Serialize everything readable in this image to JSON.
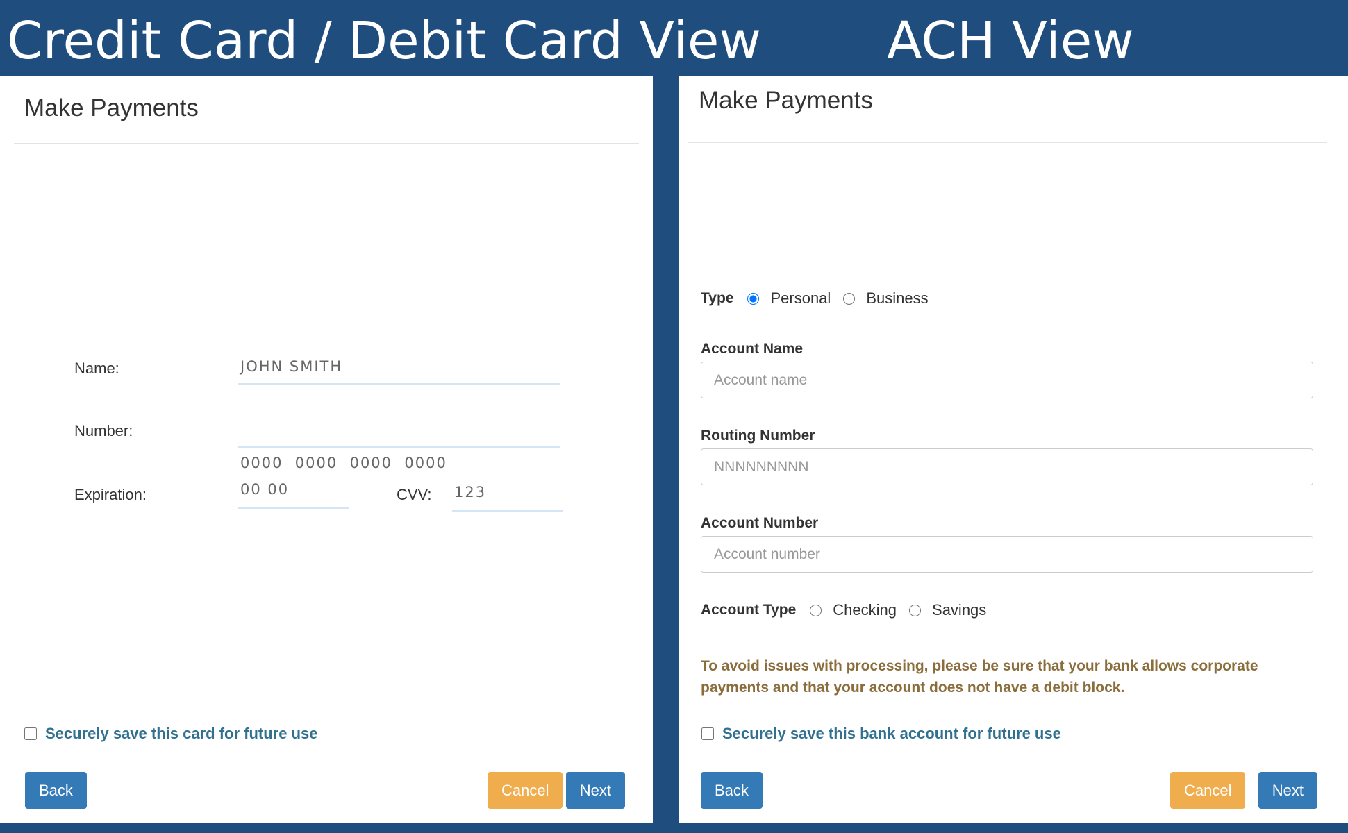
{
  "titles": {
    "cc_view": "Credit Card / Debit Card View",
    "ach_view": "ACH View"
  },
  "cc_panel": {
    "header": "Make Payments",
    "name_label": "Name:",
    "name_value": "JOHN SMITH",
    "number_label": "Number:",
    "number_value": "0000  0000  0000  0000",
    "expiration_label": "Expiration:",
    "expiration_value": "00 00",
    "cvv_label": "CVV:",
    "cvv_value": "123",
    "save_label": "Securely save this card for future use",
    "back": "Back",
    "cancel": "Cancel",
    "next": "Next"
  },
  "ach_panel": {
    "header": "Make Payments",
    "type_label": "Type",
    "type_options": [
      "Personal",
      "Business"
    ],
    "type_selected": "Personal",
    "account_name_label": "Account Name",
    "account_name_placeholder": "Account name",
    "routing_label": "Routing Number",
    "routing_placeholder": "NNNNNNNNN",
    "account_number_label": "Account Number",
    "account_number_placeholder": "Account number",
    "account_type_label": "Account Type",
    "account_type_options": [
      "Checking",
      "Savings"
    ],
    "warning": "To avoid issues with processing, please be sure that your bank allows corporate payments and that your account does not have a debit block.",
    "save_label": "Securely save this bank account for future use",
    "back": "Back",
    "cancel": "Cancel",
    "next": "Next"
  },
  "colors": {
    "background": "#1f4d7e",
    "primary": "#337ab7",
    "warning_button": "#f0ad4e",
    "save_text": "#31708f",
    "warning_text": "#8a6d3b"
  }
}
